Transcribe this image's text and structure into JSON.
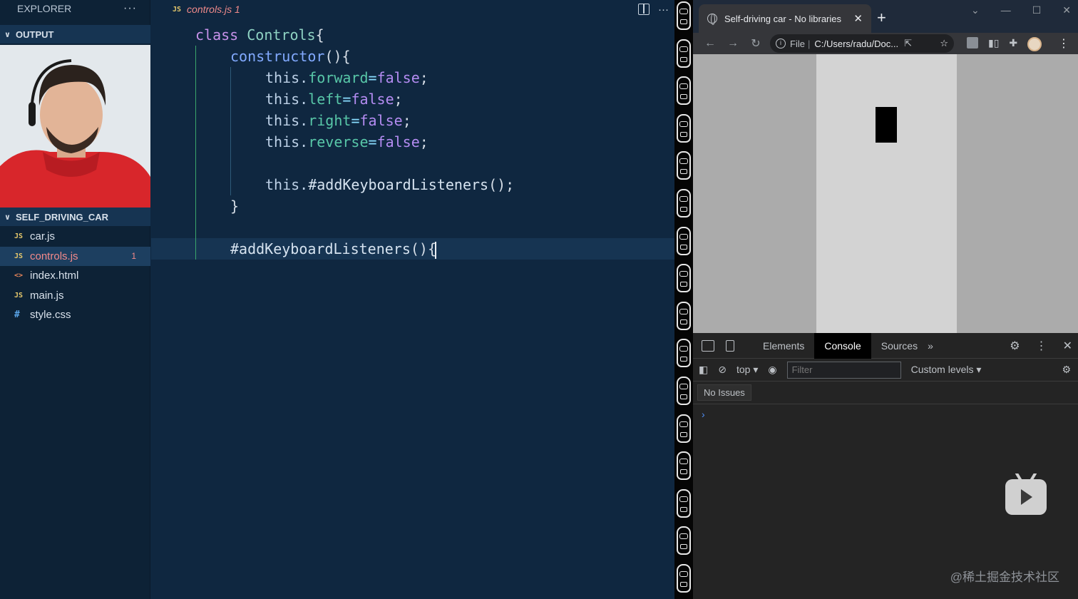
{
  "explorer": {
    "title": "EXPLORER",
    "more": "···",
    "output_label": "OUTPUT",
    "project_label": "SELF_DRIVING_CAR",
    "files": [
      {
        "icon": "JS",
        "name": "car.js",
        "badge": ""
      },
      {
        "icon": "JS",
        "name": "controls.js",
        "badge": "1"
      },
      {
        "icon": "<>",
        "name": "index.html",
        "badge": ""
      },
      {
        "icon": "JS",
        "name": "main.js",
        "badge": ""
      },
      {
        "icon": "#",
        "name": "style.css",
        "badge": ""
      }
    ]
  },
  "editor": {
    "tab_icon": "JS",
    "tab_name": "controls.js 1",
    "more": "···",
    "code": {
      "l1_kw": "class",
      "l1_cls": "Controls",
      "l1_brace": "{",
      "l2_fn": "constructor",
      "l2_rest": "(){",
      "l3_this": "this.",
      "l3_prop": "forward",
      "l3_eq": "=",
      "l3_val": "false",
      "l3_end": ";",
      "l4_this": "this.",
      "l4_prop": "left",
      "l4_eq": "=",
      "l4_val": "false",
      "l4_end": ";",
      "l5_this": "this.",
      "l5_prop": "right",
      "l5_eq": "=",
      "l5_val": "false",
      "l5_end": ";",
      "l6_this": "this.",
      "l6_prop": "reverse",
      "l6_eq": "=",
      "l6_val": "false",
      "l6_end": ";",
      "l8_this": "this.",
      "l8_call": "#addKeyboardListeners",
      "l8_end": "();",
      "l9_brace": "}",
      "l11_method": "#addKeyboardListeners",
      "l11_rest": "(){"
    }
  },
  "browser": {
    "tab_title": "Self-driving car - No libraries",
    "tab_close": "✕",
    "new_tab": "+",
    "win_min": "—",
    "win_max": "☐",
    "win_close": "✕",
    "win_chevron": "⌄",
    "nav_back": "←",
    "nav_forward": "→",
    "nav_reload": "↻",
    "address_scheme": "File",
    "address_sep": "|",
    "address": "C:/Users/radu/Doc...",
    "menu": "⋮",
    "devtools": {
      "tabs": [
        "Elements",
        "Console",
        "Sources"
      ],
      "more_tabs": "»",
      "context": "top ▾",
      "filter_placeholder": "Filter",
      "levels": "Custom levels ▾",
      "issues": "No Issues",
      "prompt": "›"
    }
  },
  "watermark": "@稀土掘金技术社区",
  "colors": {
    "editor_bg": "#0f2740",
    "keyword": "#c792ea",
    "property": "#58c7a8",
    "modified_tab": "#f08a8a",
    "road": "#d3d3d3",
    "grass": "#ababab"
  }
}
